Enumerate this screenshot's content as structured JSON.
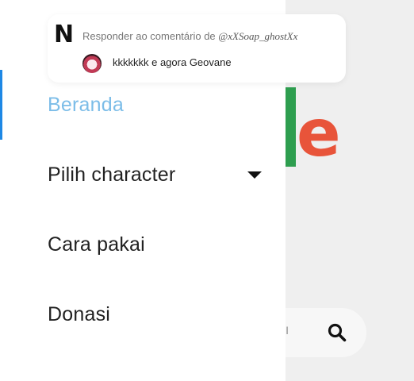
{
  "reply_overlay": {
    "header": "Responder ao comentário de",
    "username": "@xXSoap_ghostXx",
    "comment": "kkkkkkk e agora Geovane"
  },
  "drawer": {
    "items": [
      {
        "label": "Beranda",
        "active": true
      },
      {
        "label": "Pilih character",
        "has_dropdown": true
      },
      {
        "label": "Cara pakai"
      },
      {
        "label": "Donasi"
      }
    ]
  },
  "background": {
    "logo_fragment": "e",
    "search_icon": "search-icon"
  },
  "colors": {
    "active_item": "#7cbde8",
    "logo_green": "#2e9e4f",
    "logo_red": "#e8543a"
  }
}
